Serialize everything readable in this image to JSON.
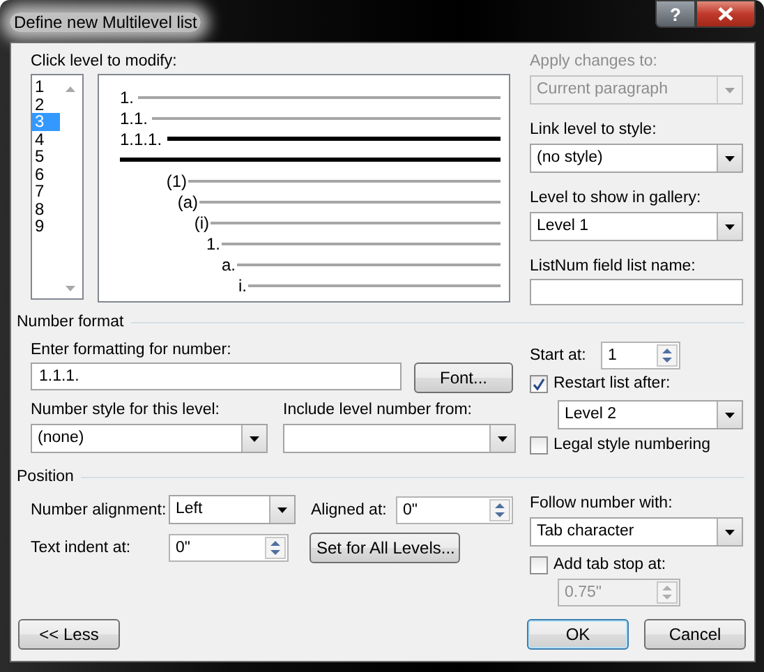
{
  "window": {
    "title": "Define new Multilevel list",
    "help_button": "?"
  },
  "levels": {
    "label": "Click level to modify:",
    "items": [
      {
        "label": "1",
        "selected": false
      },
      {
        "label": "2",
        "selected": false
      },
      {
        "label": "3",
        "selected": true
      },
      {
        "label": "4",
        "selected": false
      },
      {
        "label": "5",
        "selected": false
      },
      {
        "label": "6",
        "selected": false
      },
      {
        "label": "7",
        "selected": false
      },
      {
        "label": "8",
        "selected": false
      },
      {
        "label": "9",
        "selected": false
      }
    ]
  },
  "preview": {
    "lines": [
      {
        "number": "1.",
        "current": false
      },
      {
        "number": "1.1.",
        "current": false
      },
      {
        "number": "1.1.1.",
        "current": true
      },
      {
        "current": true
      },
      {
        "number": "(1)",
        "current": false
      },
      {
        "number": "(a)",
        "current": false
      },
      {
        "number": "(i)",
        "current": false
      },
      {
        "number": "1.",
        "current": false
      },
      {
        "number": "a.",
        "current": false
      },
      {
        "number": "i.",
        "current": false
      }
    ]
  },
  "apply_changes": {
    "label": "Apply changes to:",
    "value": "Current paragraph",
    "disabled": true
  },
  "link_level": {
    "label": "Link level to style:",
    "value": "(no style)"
  },
  "gallery_level": {
    "label": "Level to show in gallery:",
    "value": "Level 1"
  },
  "listnum": {
    "label": "ListNum field list name:"
  },
  "number_format": {
    "heading": "Number format",
    "format_label": "Enter formatting for number:",
    "format_value": "1.1.1.",
    "font_button": "Font...",
    "style_label": "Number style for this level:",
    "style_value": "(none)",
    "include_label": "Include level number from:",
    "start_label": "Start at:",
    "start_value": "1",
    "restart": {
      "label": "Restart list after:",
      "checked": true
    },
    "restart_value": "Level 2",
    "legal": {
      "label": "Legal style numbering",
      "checked": false
    }
  },
  "position": {
    "heading": "Position",
    "alignment_label": "Number alignment:",
    "alignment_value": "Left",
    "aligned_label": "Aligned at:",
    "aligned_value": "0\"",
    "indent_label": "Text indent at:",
    "indent_value": "0\"",
    "set_all_button": "Set for All Levels...",
    "follow_label": "Follow number with:",
    "follow_value": "Tab character",
    "add_tab_stop": {
      "label": "Add tab stop at:",
      "checked": false
    },
    "tab_stop_value": "0.75\"",
    "tab_stop_disabled": true
  },
  "buttons": [
    {
      "label": "<< Less",
      "default": false
    },
    {
      "label": "OK",
      "default": true
    },
    {
      "label": "Cancel",
      "default": false
    }
  ]
}
